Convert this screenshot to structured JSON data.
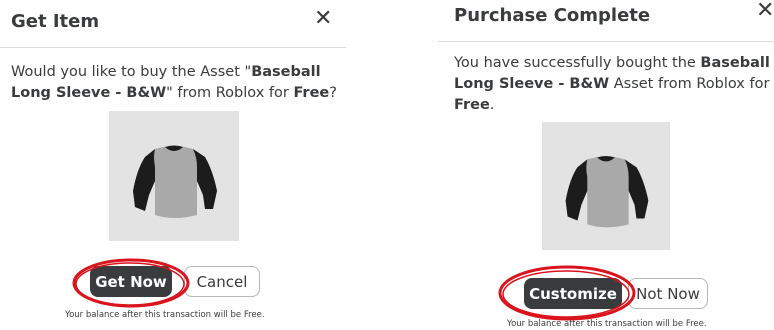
{
  "get_item": {
    "title": "Get Item",
    "close_glyph": "✕",
    "message": {
      "prefix": "Would you like to buy the Asset \"",
      "item_name": "Baseball Long Sleeve - B&W",
      "middle": "\" from Roblox for ",
      "price": "Free",
      "suffix": "?"
    },
    "primary_label": "Get Now",
    "secondary_label": "Cancel",
    "footnote": "Your balance after this transaction will be Free."
  },
  "purchase_complete": {
    "title": "Purchase Complete",
    "close_glyph": "✕",
    "message": {
      "prefix": "You have successfully bought the ",
      "item_name": "Baseball Long Sleeve - B&W",
      "middle": " Asset from Roblox for ",
      "price": "Free",
      "suffix": "."
    },
    "primary_label": "Customize",
    "secondary_label": "Not Now",
    "footnote": "Your balance after this transaction will be Free."
  },
  "colors": {
    "primary_button": "#393b3d",
    "text": "#393b3d",
    "thumbnail_bg": "#e3e3e3",
    "annotation": "#d9141c"
  },
  "icons": [
    "close-icon",
    "shirt-thumbnail"
  ]
}
